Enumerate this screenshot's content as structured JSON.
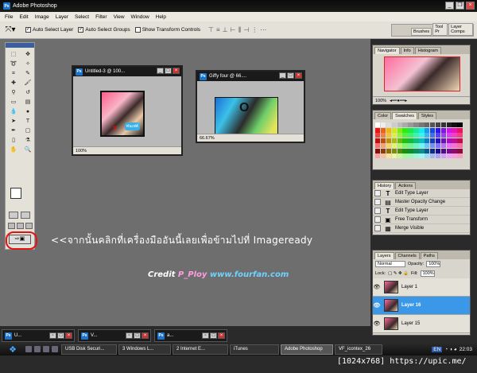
{
  "app": {
    "title": "Adobe Photoshop",
    "logo_text": "Ps"
  },
  "menu": [
    "File",
    "Edit",
    "Image",
    "Layer",
    "Select",
    "Filter",
    "View",
    "Window",
    "Help"
  ],
  "options_bar": {
    "auto_select_layer": "Auto Select Layer",
    "auto_select_groups": "Auto Select Groups",
    "show_transform_controls": "Show Transform Controls",
    "auto_select_layer_checked": true,
    "auto_select_groups_checked": true,
    "show_transform_checked": false,
    "well_tabs": [
      "Brushes",
      "Tool Pr",
      "Layer Comps"
    ]
  },
  "documents": [
    {
      "title": "Untitled-3 @ 100...",
      "zoom": "100%"
    },
    {
      "title": "Giffy four @ 66....",
      "zoom": "66.67%"
    }
  ],
  "art": {
    "bubble_text": "ฟนเฟต์"
  },
  "instruction": "<<จากนั้นคลิกที่เครื่องมืออันนี้เลยเพื่อข้ามไปที่ Imageready",
  "credit": {
    "prefix": "Credit",
    "name": "P_Ploy",
    "site": "www.fourfan.com"
  },
  "panels": {
    "navigator": {
      "tabs": [
        "Navigator",
        "Info",
        "Histogram"
      ],
      "zoom": "100%"
    },
    "color": {
      "tabs": [
        "Color",
        "Swatches",
        "Styles"
      ]
    },
    "history": {
      "tabs": [
        "History",
        "Actions"
      ],
      "items": [
        "Edit Type Layer",
        "Master Opacity Change",
        "Edit Type Layer",
        "Free Transform",
        "Merge Visible"
      ]
    },
    "layers": {
      "tabs": [
        "Layers",
        "Channels",
        "Paths"
      ],
      "blend_mode": "Normal",
      "opacity_label": "Opacity:",
      "opacity": "100%",
      "lock_label": "Lock:",
      "fill_label": "Fill:",
      "fill": "100%",
      "items": [
        {
          "name": "Layer 1",
          "selected": false
        },
        {
          "name": "Layer 16",
          "selected": true
        },
        {
          "name": "Layer 15",
          "selected": false
        }
      ]
    }
  },
  "minimized_docs": [
    "U...",
    "V...",
    "a..."
  ],
  "taskbar": {
    "items": [
      "USB Disk Securi...",
      "3 Windows L...",
      "2 Internet E...",
      "iTunes",
      "Adobe Photoshop",
      "VF_icontex_26"
    ],
    "active_index": 4,
    "language": "EN",
    "time": "22:03"
  },
  "watermark": "[1024x768] https://upic.me/"
}
